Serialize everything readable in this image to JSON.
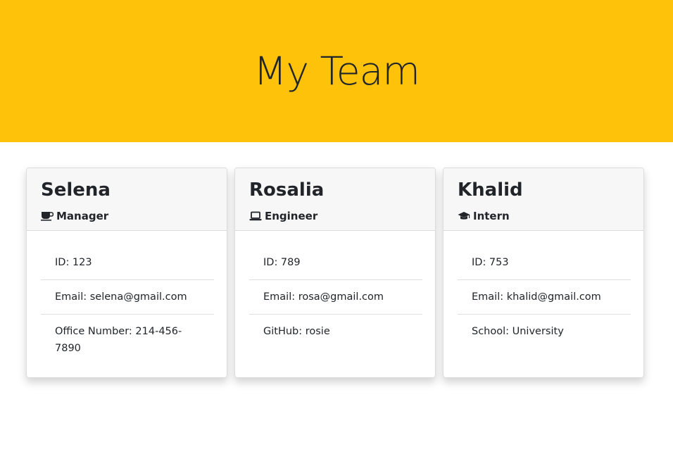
{
  "header": {
    "title": "My Team",
    "background": "#fec20a"
  },
  "cards": [
    {
      "name": "Selena",
      "role": "Manager",
      "role_icon": "coffee-icon",
      "details": [
        "ID: 123",
        "Email: selena@gmail.com",
        "Office Number: 214-456-7890"
      ]
    },
    {
      "name": "Rosalia",
      "role": "Engineer",
      "role_icon": "laptop-icon",
      "details": [
        "ID: 789",
        "Email: rosa@gmail.com",
        "GitHub: rosie"
      ]
    },
    {
      "name": "Khalid",
      "role": "Intern",
      "role_icon": "graduation-cap-icon",
      "details": [
        "ID: 753",
        "Email: khalid@gmail.com",
        "School: University"
      ]
    }
  ]
}
